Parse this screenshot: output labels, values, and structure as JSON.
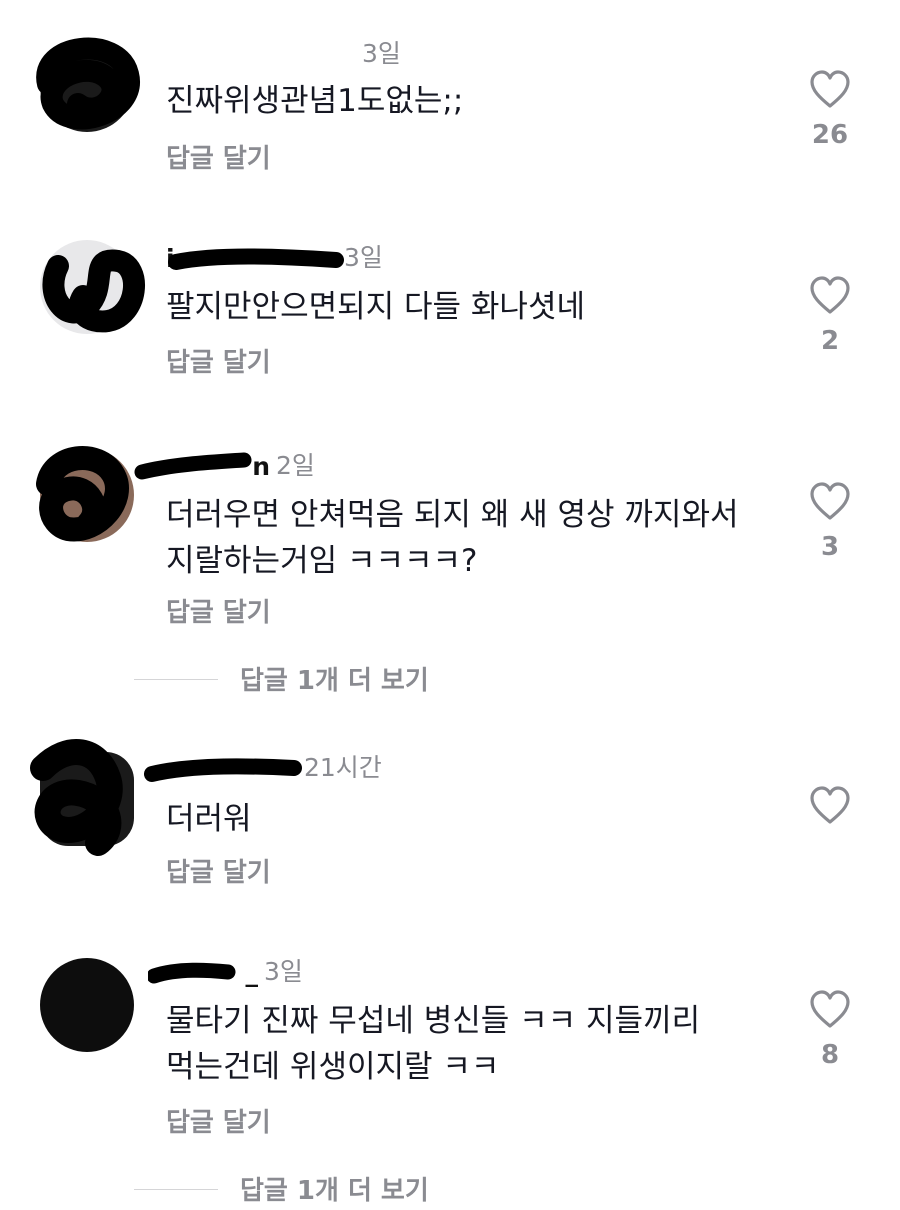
{
  "colors": {
    "text": "#161823",
    "muted": "#8a8b91",
    "redaction": "#000000"
  },
  "icons": {
    "like": "heart-outline-icon"
  },
  "comments": [
    {
      "username": "",
      "time": "3일",
      "text": "진짜위생관념1도없는;;",
      "reply": "답글 달기",
      "likes": "26"
    },
    {
      "username": "i",
      "time": "3일",
      "text": "팔지만안으면되지 다들 화나셧네",
      "reply": "답글 달기",
      "likes": "2"
    },
    {
      "username": "n",
      "time": "2일",
      "text_lines": [
        "더러우면 안쳐먹음 되지 왜 새 영상 까지와서",
        "지랄하는거임 ㅋㅋㅋㅋ?"
      ],
      "reply": "답글 달기",
      "likes": "3"
    },
    {
      "username": "",
      "time": "21시간",
      "text": "더러워",
      "reply": "답글 달기",
      "likes": ""
    },
    {
      "username": "_",
      "time": "3일",
      "text_lines": [
        "물타기 진짜 무섭네 병신들 ㅋㅋ 지들끼리",
        "먹는건데 위생이지랄 ㅋㅋ"
      ],
      "reply": "답글 달기",
      "likes": "8"
    }
  ],
  "more_replies": [
    {
      "label": "답글 1개 더 보기"
    },
    {
      "label": "답글 1개 더 보기"
    }
  ]
}
